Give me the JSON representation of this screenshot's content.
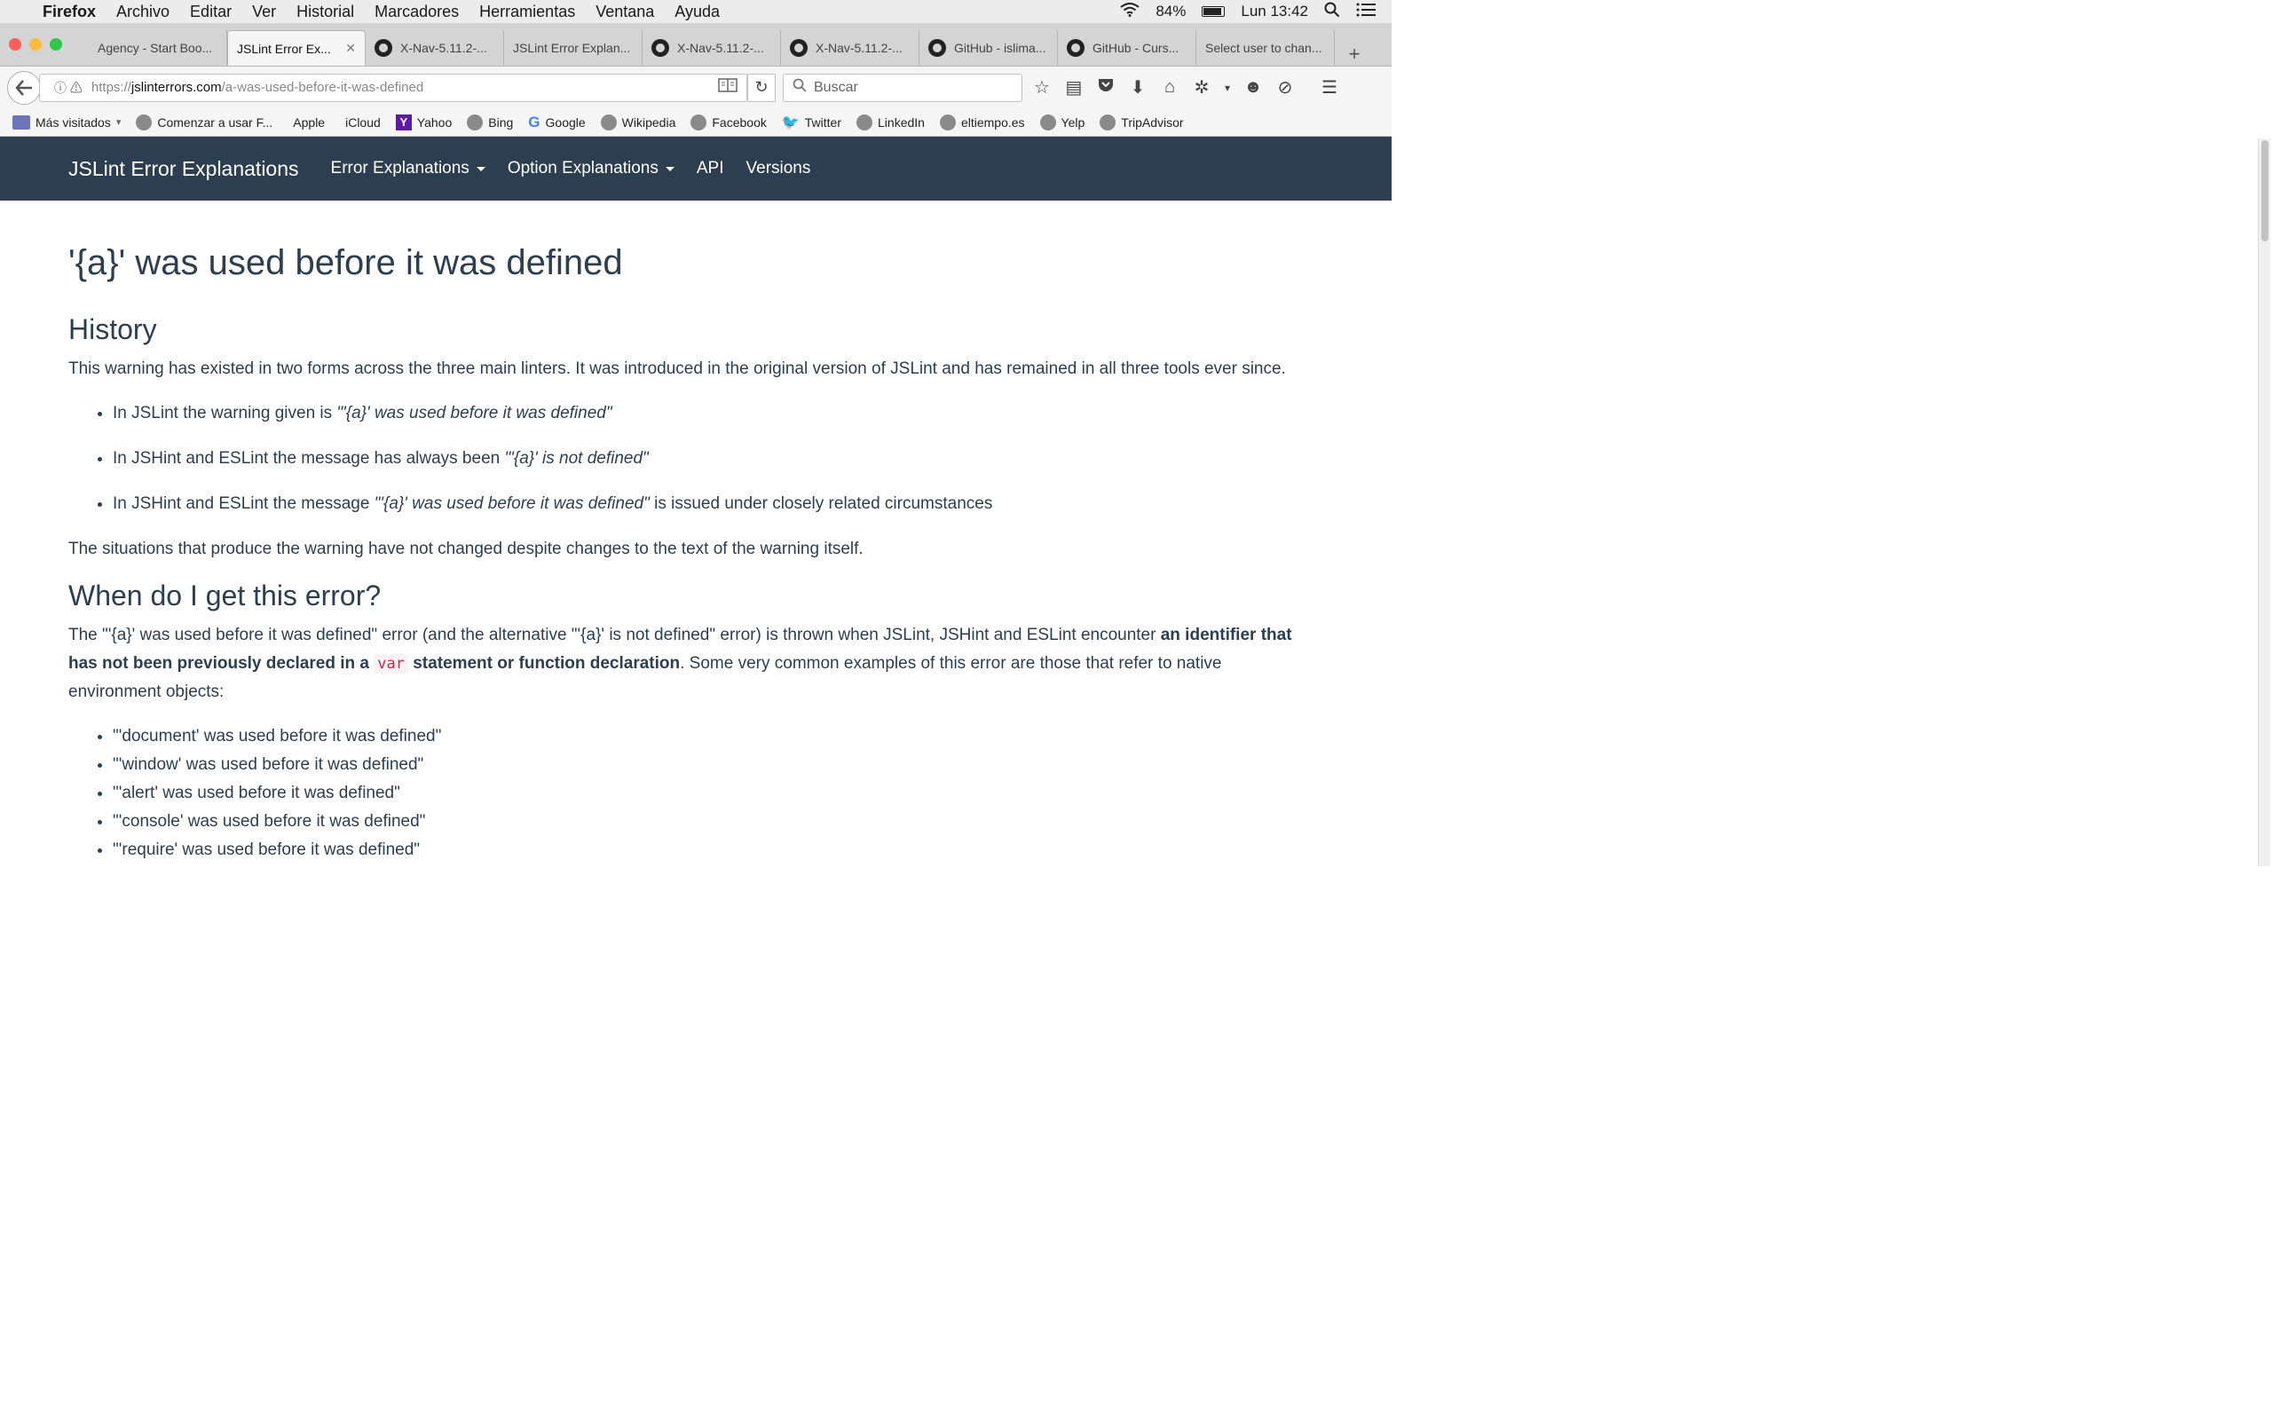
{
  "menubar": {
    "app": "Firefox",
    "items": [
      "Archivo",
      "Editar",
      "Ver",
      "Historial",
      "Marcadores",
      "Herramientas",
      "Ventana",
      "Ayuda"
    ],
    "battery": "84%",
    "clock": "Lun 13:42"
  },
  "tabs": [
    {
      "label": "Agency - Start Boo...",
      "icon": "none"
    },
    {
      "label": "JSLint Error Ex...",
      "icon": "none",
      "active": true
    },
    {
      "label": "X-Nav-5.11.2-...",
      "icon": "github"
    },
    {
      "label": "JSLint Error Explan...",
      "icon": "none"
    },
    {
      "label": "X-Nav-5.11.2-...",
      "icon": "github"
    },
    {
      "label": "X-Nav-5.11.2-...",
      "icon": "github"
    },
    {
      "label": "GitHub - islima...",
      "icon": "github"
    },
    {
      "label": "GitHub - Curs...",
      "icon": "github"
    },
    {
      "label": "Select user to chan...",
      "icon": "none"
    }
  ],
  "url": {
    "prefix": "https://",
    "domain": "jslinterrors.com",
    "path": "/a-was-used-before-it-was-defined"
  },
  "search": {
    "placeholder": "Buscar"
  },
  "bookmarks": [
    {
      "label": "Más visitados",
      "icon": "folder"
    },
    {
      "label": "Comenzar a usar F...",
      "icon": "globe"
    },
    {
      "label": "Apple",
      "icon": "apple"
    },
    {
      "label": "iCloud",
      "icon": "apple"
    },
    {
      "label": "Yahoo",
      "icon": "yahoo"
    },
    {
      "label": "Bing",
      "icon": "globe"
    },
    {
      "label": "Google",
      "icon": "google"
    },
    {
      "label": "Wikipedia",
      "icon": "globe"
    },
    {
      "label": "Facebook",
      "icon": "globe"
    },
    {
      "label": "Twitter",
      "icon": "twitter"
    },
    {
      "label": "LinkedIn",
      "icon": "globe"
    },
    {
      "label": "eltiempo.es",
      "icon": "globe"
    },
    {
      "label": "Yelp",
      "icon": "globe"
    },
    {
      "label": "TripAdvisor",
      "icon": "globe"
    }
  ],
  "site": {
    "brand": "JSLint Error Explanations",
    "nav": [
      {
        "label": "Error Explanations",
        "dropdown": true
      },
      {
        "label": "Option Explanations",
        "dropdown": true
      },
      {
        "label": "API",
        "dropdown": false
      },
      {
        "label": "Versions",
        "dropdown": false
      }
    ]
  },
  "article": {
    "title": "'{a}' was used before it was defined",
    "history_heading": "History",
    "history_intro": "This warning has existed in two forms across the three main linters. It was introduced in the original version of JSLint and has remained in all three tools ever since.",
    "history_items": [
      {
        "pre": "In JSLint the warning given is ",
        "em": "\"'{a}' was used before it was defined\"",
        "post": ""
      },
      {
        "pre": "In JSHint and ESLint the message has always been ",
        "em": "\"'{a}' is not defined\"",
        "post": ""
      },
      {
        "pre": "In JSHint and ESLint the message ",
        "em": "\"'{a}' was used before it was defined\"",
        "post": " is issued under closely related circumstances"
      }
    ],
    "history_outro": "The situations that produce the warning have not changed despite changes to the text of the warning itself.",
    "when_heading": "When do I get this error?",
    "when_p1": "The \"'{a}' was used before it was defined\" error (and the alternative \"'{a}' is not defined\" error) is thrown when JSLint, JSHint and ESLint encounter ",
    "when_bold1": "an identifier that has not been previously declared in a",
    "when_code": "var",
    "when_bold2": "statement or function declaration",
    "when_p2": ". Some very common examples of this error are those that refer to native environment objects:",
    "examples": [
      "\"'document' was used before it was defined\"",
      "\"'window' was used before it was defined\"",
      "\"'alert' was used before it was defined\"",
      "\"'console' was used before it was defined\"",
      "\"'require' was used before it was defined\""
    ]
  },
  "colors": {
    "site_nav": "#2c3e50",
    "text": "#2c3e50",
    "code": "#c7254e"
  }
}
